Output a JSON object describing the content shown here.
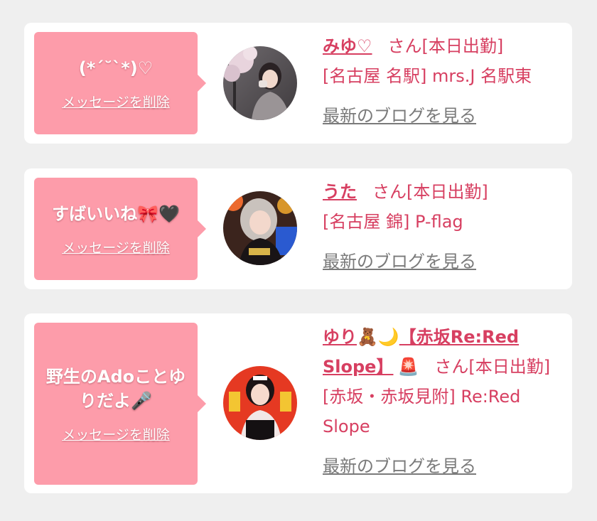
{
  "cards": [
    {
      "message": "(*´˘`*)♡",
      "delete_label": "メッセージを削除",
      "name": "みゆ♡",
      "suffix": "さん[本日出勤]",
      "shop": "[名古屋 名駅] mrs.J 名駅東",
      "blog_label": "最新のブログを見る"
    },
    {
      "message": "すばいいね🎀🖤",
      "delete_label": "メッセージを削除",
      "name": "うた",
      "suffix": "さん[本日出勤]",
      "shop": "[名古屋 錦] P-flag",
      "blog_label": "最新のブログを見る"
    },
    {
      "message_line1": "野生のAdoことゆ",
      "message_line2": "りだよ🎤",
      "delete_label": "メッセージを削除",
      "name_part1": "ゆり",
      "name_emoji1": "🧸🌙",
      "name_part2": "【赤坂Re:Red",
      "name_part3": "Slope】",
      "name_emoji2": "🚨",
      "suffix": "さん[本日出勤]",
      "shop_line1": "[赤坂・赤坂見附] Re:Red",
      "shop_line2": "Slope",
      "blog_label": "最新のブログを見る"
    }
  ],
  "colors": {
    "background": "#efefef",
    "card": "#ffffff",
    "bubble": "#fd9caa",
    "accent_text": "#d73f61",
    "link_gray": "#7a7a7a"
  }
}
